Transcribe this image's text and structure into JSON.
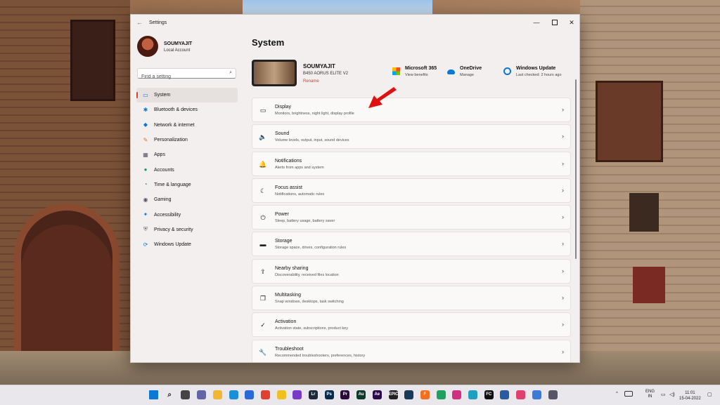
{
  "window": {
    "app_title": "Settings",
    "back_icon": "←",
    "minimize": "—",
    "close": "✕"
  },
  "user": {
    "name": "SOUMYAJIT",
    "account_type": "Local Account"
  },
  "search": {
    "placeholder": "Find a setting",
    "icon": "⌕"
  },
  "sidebar": {
    "items": [
      {
        "label": "System",
        "icon": "▭",
        "color": "#0a78d4",
        "active": true
      },
      {
        "label": "Bluetooth & devices",
        "icon": "✱",
        "color": "#0a78d4"
      },
      {
        "label": "Network & internet",
        "icon": "◆",
        "color": "#0a78d4"
      },
      {
        "label": "Personalization",
        "icon": "✎",
        "color": "#e07020"
      },
      {
        "label": "Apps",
        "icon": "▦",
        "color": "#556"
      },
      {
        "label": "Accounts",
        "icon": "●",
        "color": "#1a9a6a"
      },
      {
        "label": "Time & language",
        "icon": "◔",
        "color": "#0a78d4"
      },
      {
        "label": "Gaming",
        "icon": "◉",
        "color": "#556"
      },
      {
        "label": "Accessibility",
        "icon": "✦",
        "color": "#0a78d4"
      },
      {
        "label": "Privacy & security",
        "icon": "⛨",
        "color": "#667"
      },
      {
        "label": "Windows Update",
        "icon": "⟳",
        "color": "#0a78d4"
      }
    ]
  },
  "main": {
    "title": "System",
    "device": {
      "name": "SOUMYAJIT",
      "model": "B450 AORUS ELITE V2",
      "rename": "Rename"
    },
    "quick": [
      {
        "title": "Microsoft 365",
        "sub": "View benefits"
      },
      {
        "title": "OneDrive",
        "sub": "Manage"
      },
      {
        "title": "Windows Update",
        "sub": "Last checked: 2 hours ago"
      }
    ],
    "rows": [
      {
        "title": "Display",
        "sub": "Monitors, brightness, night light, display profile",
        "icon": "▭"
      },
      {
        "title": "Sound",
        "sub": "Volume levels, output, input, sound devices",
        "icon": "🔈"
      },
      {
        "title": "Notifications",
        "sub": "Alerts from apps and system",
        "icon": "🔔"
      },
      {
        "title": "Focus assist",
        "sub": "Notifications, automatic rules",
        "icon": "☾"
      },
      {
        "title": "Power",
        "sub": "Sleep, battery usage, battery saver",
        "icon": "⏻"
      },
      {
        "title": "Storage",
        "sub": "Storage space, drives, configuration rules",
        "icon": "▬"
      },
      {
        "title": "Nearby sharing",
        "sub": "Discoverability, received files location",
        "icon": "⇪"
      },
      {
        "title": "Multitasking",
        "sub": "Snap windows, desktops, task switching",
        "icon": "❐"
      },
      {
        "title": "Activation",
        "sub": "Activation state, subscriptions, product key",
        "icon": "✓"
      },
      {
        "title": "Troubleshoot",
        "sub": "Recommended troubleshooters, preferences, history",
        "icon": "🔧"
      }
    ],
    "chevron": "›"
  },
  "taskbar": {
    "apps": [
      {
        "name": "start",
        "label": "",
        "color": "#0a78d4"
      },
      {
        "name": "search",
        "label": "⌕",
        "color": "#e9e7ec"
      },
      {
        "name": "task-view",
        "label": "",
        "color": "#444"
      },
      {
        "name": "teams",
        "label": "",
        "color": "#6264a7"
      },
      {
        "name": "explorer",
        "label": "",
        "color": "#f2b632"
      },
      {
        "name": "edge",
        "label": "",
        "color": "#1a8fd8"
      },
      {
        "name": "store",
        "label": "",
        "color": "#2a6ad8"
      },
      {
        "name": "chrome",
        "label": "",
        "color": "#e04030"
      },
      {
        "name": "app-yellow",
        "label": "",
        "color": "#f0c020"
      },
      {
        "name": "app-purple",
        "label": "",
        "color": "#7a3ac8"
      },
      {
        "name": "lightroom",
        "label": "Lr",
        "color": "#1a2a3a"
      },
      {
        "name": "photoshop",
        "label": "Ps",
        "color": "#0a2a4a"
      },
      {
        "name": "premiere",
        "label": "Pr",
        "color": "#2a0a3a"
      },
      {
        "name": "audition",
        "label": "Au",
        "color": "#0a3a2a"
      },
      {
        "name": "after-effects",
        "label": "Ae",
        "color": "#2a0a4a"
      },
      {
        "name": "epic",
        "label": "EPIC",
        "color": "#222"
      },
      {
        "name": "steam",
        "label": "",
        "color": "#1a3a5a"
      },
      {
        "name": "app-f",
        "label": "F",
        "color": "#f07020"
      },
      {
        "name": "app-green",
        "label": "",
        "color": "#20a060"
      },
      {
        "name": "instagram",
        "label": "",
        "color": "#d03080"
      },
      {
        "name": "app-teal",
        "label": "",
        "color": "#20a0c0"
      },
      {
        "name": "app-fc",
        "label": "FC",
        "color": "#111"
      },
      {
        "name": "app-blue",
        "label": "",
        "color": "#2a5aa0"
      },
      {
        "name": "app-pink",
        "label": "",
        "color": "#e04070"
      },
      {
        "name": "app-white",
        "label": "",
        "color": "#3a7ad8"
      },
      {
        "name": "settings",
        "label": "",
        "color": "#556"
      }
    ],
    "lang": "ENG",
    "region": "IN",
    "time": "11:01",
    "date": "15-04-2022",
    "tray_chevron": "^"
  }
}
